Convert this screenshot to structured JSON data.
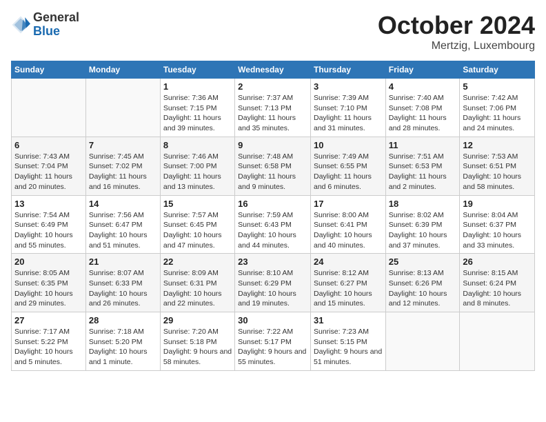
{
  "header": {
    "logo_general": "General",
    "logo_blue": "Blue",
    "month": "October 2024",
    "location": "Mertzig, Luxembourg"
  },
  "weekdays": [
    "Sunday",
    "Monday",
    "Tuesday",
    "Wednesday",
    "Thursday",
    "Friday",
    "Saturday"
  ],
  "weeks": [
    [
      {
        "day": "",
        "info": ""
      },
      {
        "day": "",
        "info": ""
      },
      {
        "day": "1",
        "info": "Sunrise: 7:36 AM\nSunset: 7:15 PM\nDaylight: 11 hours and 39 minutes."
      },
      {
        "day": "2",
        "info": "Sunrise: 7:37 AM\nSunset: 7:13 PM\nDaylight: 11 hours and 35 minutes."
      },
      {
        "day": "3",
        "info": "Sunrise: 7:39 AM\nSunset: 7:10 PM\nDaylight: 11 hours and 31 minutes."
      },
      {
        "day": "4",
        "info": "Sunrise: 7:40 AM\nSunset: 7:08 PM\nDaylight: 11 hours and 28 minutes."
      },
      {
        "day": "5",
        "info": "Sunrise: 7:42 AM\nSunset: 7:06 PM\nDaylight: 11 hours and 24 minutes."
      }
    ],
    [
      {
        "day": "6",
        "info": "Sunrise: 7:43 AM\nSunset: 7:04 PM\nDaylight: 11 hours and 20 minutes."
      },
      {
        "day": "7",
        "info": "Sunrise: 7:45 AM\nSunset: 7:02 PM\nDaylight: 11 hours and 16 minutes."
      },
      {
        "day": "8",
        "info": "Sunrise: 7:46 AM\nSunset: 7:00 PM\nDaylight: 11 hours and 13 minutes."
      },
      {
        "day": "9",
        "info": "Sunrise: 7:48 AM\nSunset: 6:58 PM\nDaylight: 11 hours and 9 minutes."
      },
      {
        "day": "10",
        "info": "Sunrise: 7:49 AM\nSunset: 6:55 PM\nDaylight: 11 hours and 6 minutes."
      },
      {
        "day": "11",
        "info": "Sunrise: 7:51 AM\nSunset: 6:53 PM\nDaylight: 11 hours and 2 minutes."
      },
      {
        "day": "12",
        "info": "Sunrise: 7:53 AM\nSunset: 6:51 PM\nDaylight: 10 hours and 58 minutes."
      }
    ],
    [
      {
        "day": "13",
        "info": "Sunrise: 7:54 AM\nSunset: 6:49 PM\nDaylight: 10 hours and 55 minutes."
      },
      {
        "day": "14",
        "info": "Sunrise: 7:56 AM\nSunset: 6:47 PM\nDaylight: 10 hours and 51 minutes."
      },
      {
        "day": "15",
        "info": "Sunrise: 7:57 AM\nSunset: 6:45 PM\nDaylight: 10 hours and 47 minutes."
      },
      {
        "day": "16",
        "info": "Sunrise: 7:59 AM\nSunset: 6:43 PM\nDaylight: 10 hours and 44 minutes."
      },
      {
        "day": "17",
        "info": "Sunrise: 8:00 AM\nSunset: 6:41 PM\nDaylight: 10 hours and 40 minutes."
      },
      {
        "day": "18",
        "info": "Sunrise: 8:02 AM\nSunset: 6:39 PM\nDaylight: 10 hours and 37 minutes."
      },
      {
        "day": "19",
        "info": "Sunrise: 8:04 AM\nSunset: 6:37 PM\nDaylight: 10 hours and 33 minutes."
      }
    ],
    [
      {
        "day": "20",
        "info": "Sunrise: 8:05 AM\nSunset: 6:35 PM\nDaylight: 10 hours and 29 minutes."
      },
      {
        "day": "21",
        "info": "Sunrise: 8:07 AM\nSunset: 6:33 PM\nDaylight: 10 hours and 26 minutes."
      },
      {
        "day": "22",
        "info": "Sunrise: 8:09 AM\nSunset: 6:31 PM\nDaylight: 10 hours and 22 minutes."
      },
      {
        "day": "23",
        "info": "Sunrise: 8:10 AM\nSunset: 6:29 PM\nDaylight: 10 hours and 19 minutes."
      },
      {
        "day": "24",
        "info": "Sunrise: 8:12 AM\nSunset: 6:27 PM\nDaylight: 10 hours and 15 minutes."
      },
      {
        "day": "25",
        "info": "Sunrise: 8:13 AM\nSunset: 6:26 PM\nDaylight: 10 hours and 12 minutes."
      },
      {
        "day": "26",
        "info": "Sunrise: 8:15 AM\nSunset: 6:24 PM\nDaylight: 10 hours and 8 minutes."
      }
    ],
    [
      {
        "day": "27",
        "info": "Sunrise: 7:17 AM\nSunset: 5:22 PM\nDaylight: 10 hours and 5 minutes."
      },
      {
        "day": "28",
        "info": "Sunrise: 7:18 AM\nSunset: 5:20 PM\nDaylight: 10 hours and 1 minute."
      },
      {
        "day": "29",
        "info": "Sunrise: 7:20 AM\nSunset: 5:18 PM\nDaylight: 9 hours and 58 minutes."
      },
      {
        "day": "30",
        "info": "Sunrise: 7:22 AM\nSunset: 5:17 PM\nDaylight: 9 hours and 55 minutes."
      },
      {
        "day": "31",
        "info": "Sunrise: 7:23 AM\nSunset: 5:15 PM\nDaylight: 9 hours and 51 minutes."
      },
      {
        "day": "",
        "info": ""
      },
      {
        "day": "",
        "info": ""
      }
    ]
  ]
}
